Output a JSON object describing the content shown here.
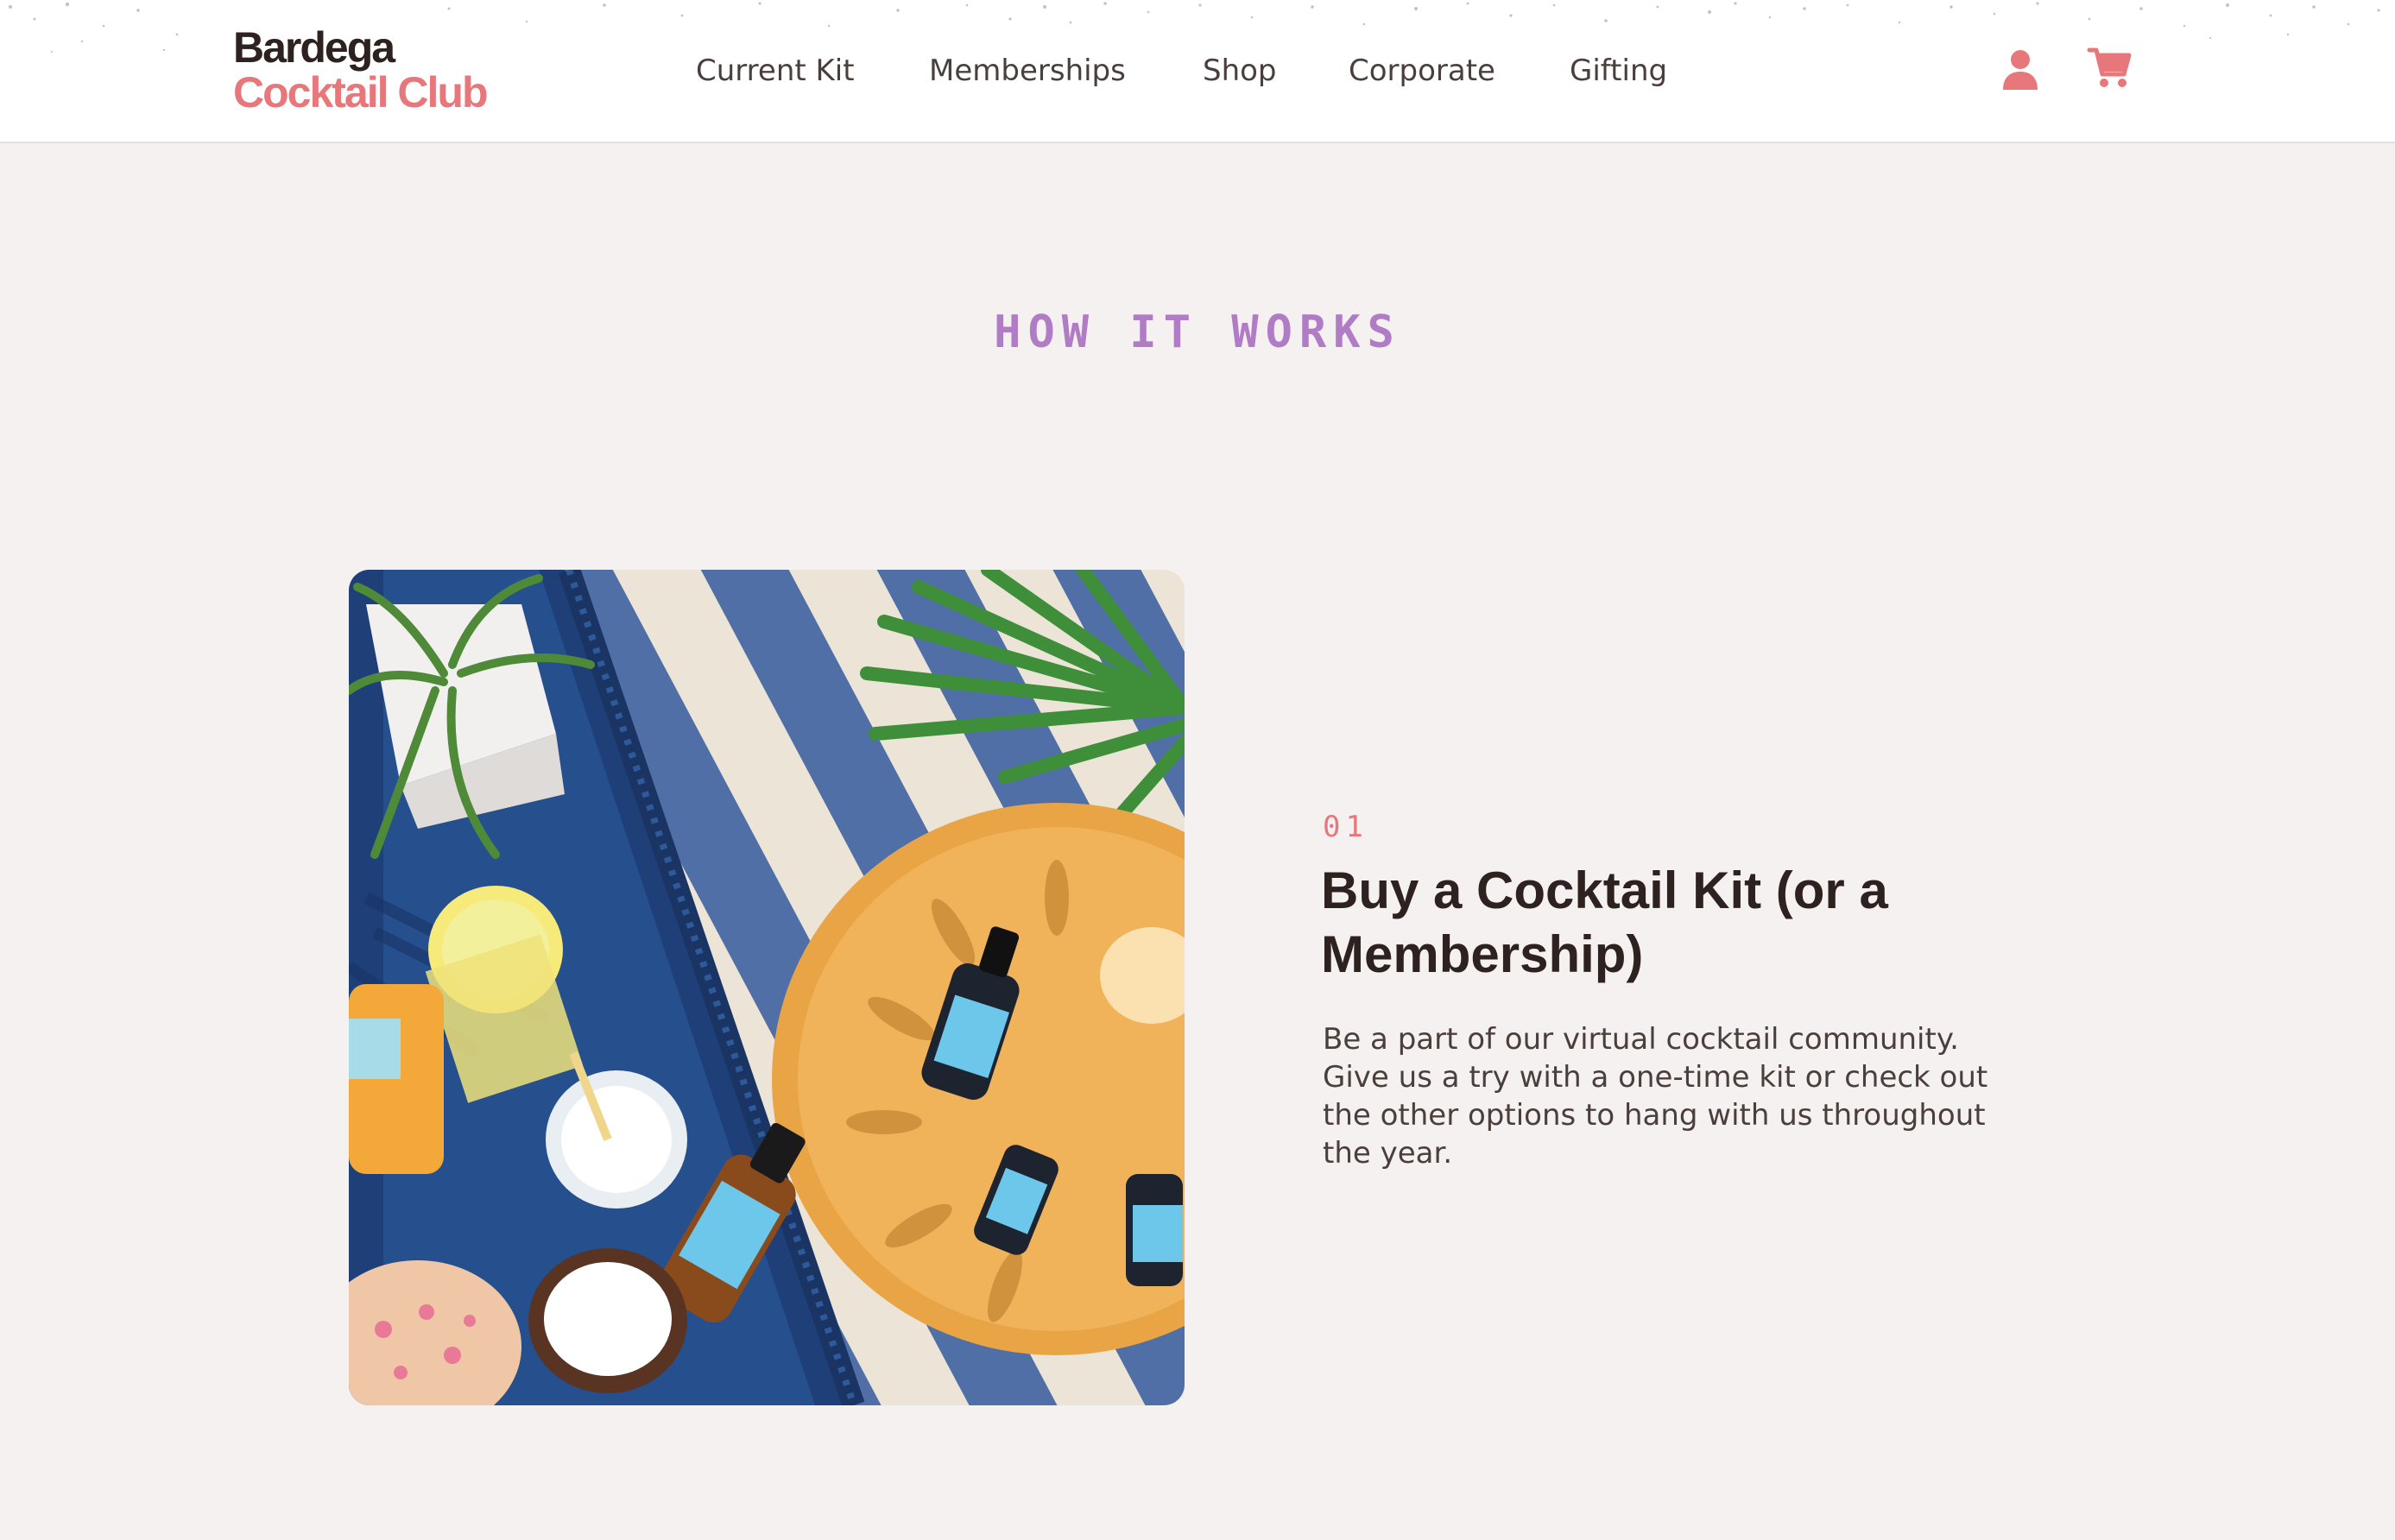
{
  "brand": {
    "name_line1": "Bardega",
    "name_line2": "Cocktail Club",
    "colors": {
      "dark": "#2e2220",
      "accent": "#e8777b",
      "lavender": "#b07cc6",
      "background": "#f5f1f0"
    }
  },
  "nav": {
    "items": [
      {
        "label": "Current Kit"
      },
      {
        "label": "Memberships"
      },
      {
        "label": "Shop"
      },
      {
        "label": "Corporate"
      },
      {
        "label": "Gifting"
      }
    ],
    "icons": [
      "account-icon",
      "cart-icon"
    ]
  },
  "how_it_works": {
    "title": "HOW IT WORKS",
    "steps": [
      {
        "number": "01",
        "heading": "Buy a Cocktail Kit (or a Membership)",
        "body": "Be a part of our virtual cocktail community. Give us a try with a one-time kit or check out the other options to hang with us throughout the year.",
        "image": "cocktail-kit-photo"
      }
    ]
  }
}
